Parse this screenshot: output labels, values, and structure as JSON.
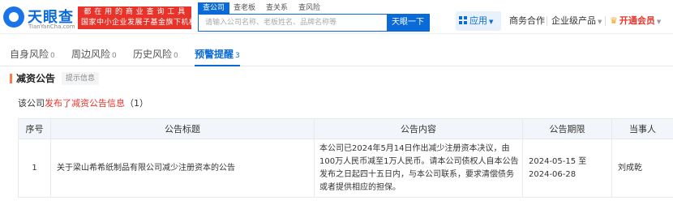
{
  "header": {
    "logo_cn": "天眼查",
    "logo_en": "TianYanCha.com",
    "badge_line1": "都 在 用 的 商 业 查 询 工 具",
    "badge_line2": "国家中小企业发展子基金旗下机构",
    "search_tabs": [
      "查公司",
      "查老板",
      "查关系",
      "查风险"
    ],
    "search_placeholder": "请输入公司名称、老板姓名、品牌名称等",
    "search_button": "天眼一下",
    "nav_apps": "应用",
    "nav_cooperation": "商务合作",
    "nav_enterprise": "企业级产品",
    "nav_vip": "开通会员"
  },
  "risk_tabs": [
    {
      "label": "自身风险",
      "count": "0"
    },
    {
      "label": "周边风险",
      "count": "0"
    },
    {
      "label": "历史风险",
      "count": "0"
    },
    {
      "label": "预警提醒",
      "count": "3"
    }
  ],
  "section": {
    "title": "减资公告",
    "tag": "提示信息",
    "summary_prefix": "该公司",
    "summary_highlight": "发布了减资公告信息",
    "summary_count": "（1）"
  },
  "table": {
    "headers": [
      "序号",
      "公告标题",
      "公告内容",
      "公告期限",
      "当事人"
    ],
    "rows": [
      {
        "index": "1",
        "title": "关于梁山希希纸制品有限公司减少注册资本的公告",
        "content": "本公司已2024年5月14日作出减少注册资本决议，由100万人民币减至1万人民币。请本公司债权人自本公告发布之日起四十五日内，与本公司联系，要求清偿债务或者提供相应的担保。",
        "period": "2024-05-15 至 2024-06-28",
        "party": "刘成乾"
      }
    ]
  },
  "colors": {
    "accent": "#0a6bd8",
    "highlight": "#e8332a",
    "section_bar": "#ff7a45"
  }
}
